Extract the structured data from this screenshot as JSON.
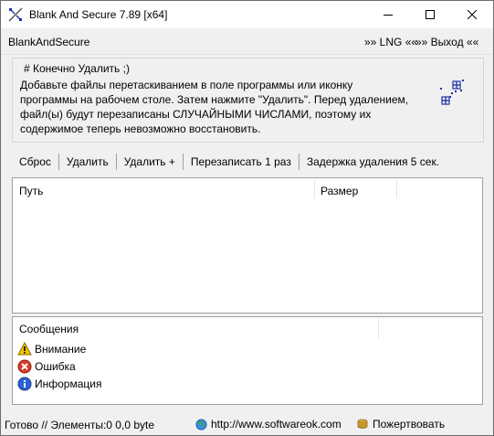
{
  "window": {
    "title": "Blank And Secure 7.89 [x64]"
  },
  "menu": {
    "app_name": "BlankAndSecure",
    "lng": "»» LNG ««",
    "exit": "»» Выход ««"
  },
  "info": {
    "heading": "# Конечно Удалить ;)",
    "text": "Добавьте файлы перетаскиванием в поле программы или иконку\nпрограммы на рабочем столе. Затем нажмите \"Удалить\". Перед удалением,\nфайл(ы) будут перезаписаны СЛУЧАЙНЫМИ ЧИСЛАМИ, поэтому их\nсодержимое теперь невозможно восстановить."
  },
  "toolbar": {
    "reset": "Сброс",
    "delete": "Удалить",
    "delete_plus": "Удалить +",
    "overwrite": "Перезаписать 1 раз",
    "delay": "Задержка удаления 5 сек."
  },
  "file_list": {
    "columns": [
      "Путь",
      "Размер"
    ],
    "rows": []
  },
  "messages": {
    "header": "Сообщения",
    "items": [
      {
        "icon": "warning-icon",
        "label": "Внимание"
      },
      {
        "icon": "error-icon",
        "label": "Ошибка"
      },
      {
        "icon": "info-icon",
        "label": "Информация"
      }
    ]
  },
  "status": {
    "text": "Готово // Элементы:0 0,0 byte",
    "website": "http://www.softwareok.com",
    "donate": "Пожертвовать"
  },
  "colors": {
    "warning": "#f3c700",
    "error": "#d83b2c",
    "info": "#2b62d9",
    "logo": "#2233aa"
  }
}
